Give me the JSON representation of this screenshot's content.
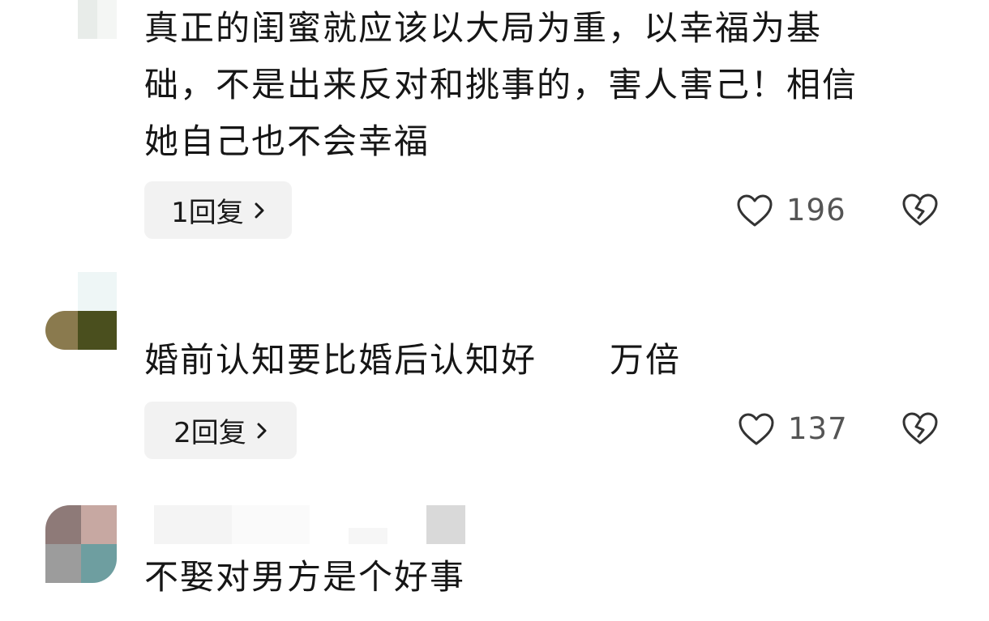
{
  "comments": [
    {
      "text_lines": [
        "真正的闺蜜就应该以大局为重，以幸福为基",
        "础，不是出来反对和挑事的，害人害己！相信",
        "她自己也不会幸福"
      ],
      "reply_label": "1回复",
      "like_count": "196"
    },
    {
      "text_lines": [
        "婚前认知要比婚后认知好",
        "万倍"
      ],
      "reply_label": "2回复",
      "like_count": "137"
    },
    {
      "text_lines": [
        "不娶对男方是个好事"
      ]
    }
  ],
  "icons": {
    "like": "heart-outline-icon",
    "dislike": "broken-heart-icon",
    "reply_arrow": "chevron-right-icon"
  },
  "colors": {
    "icon_gray": "#333333",
    "count_gray": "#555555",
    "reply_bg": "#f2f2f2"
  }
}
